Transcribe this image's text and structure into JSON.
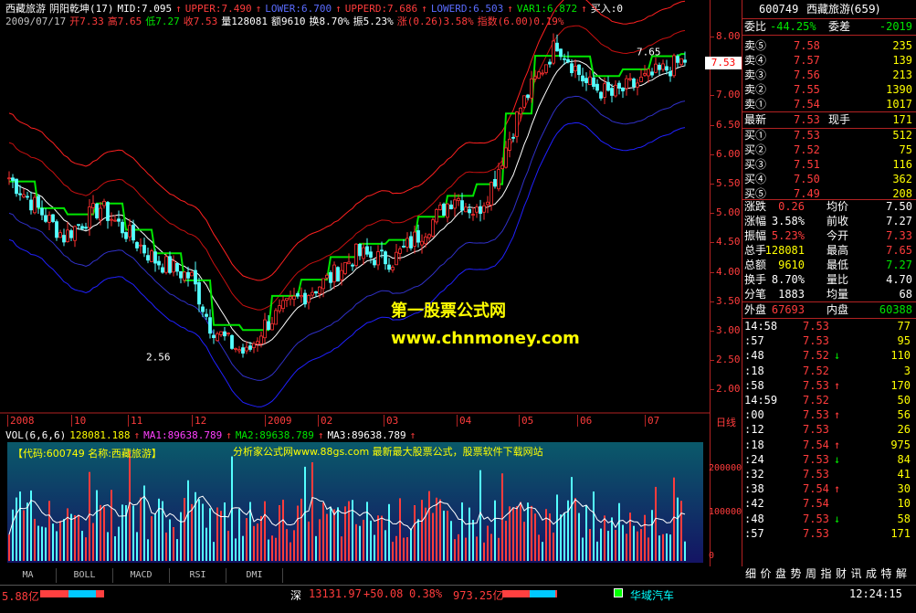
{
  "header": {
    "line1": [
      {
        "t": "西藏旅游",
        "c": "wht"
      },
      {
        "t": "阴阳乾坤(17)",
        "c": "wht"
      },
      {
        "t": "MID:7.095",
        "c": "wht"
      },
      {
        "t": "↑",
        "c": "red"
      },
      {
        "t": "UPPER:7.490",
        "c": "red"
      },
      {
        "t": "↑",
        "c": "red"
      },
      {
        "t": "LOWER:6.700",
        "c": "blu"
      },
      {
        "t": "↑",
        "c": "red"
      },
      {
        "t": "UPPERD:7.686",
        "c": "red"
      },
      {
        "t": "↑",
        "c": "red"
      },
      {
        "t": "LOWERD:6.503",
        "c": "blu"
      },
      {
        "t": "↑",
        "c": "red"
      },
      {
        "t": "VAR1:6.872",
        "c": "grn"
      },
      {
        "t": "↑",
        "c": "red"
      },
      {
        "t": "买入:0",
        "c": "wht"
      }
    ],
    "line2": [
      {
        "t": "2009/07/17",
        "c": "gry"
      },
      {
        "t": "开7.33",
        "c": "red"
      },
      {
        "t": "高7.65",
        "c": "red"
      },
      {
        "t": "低7.27",
        "c": "grn"
      },
      {
        "t": "收7.53",
        "c": "red"
      },
      {
        "t": "量128081",
        "c": "wht"
      },
      {
        "t": "额9610",
        "c": "wht"
      },
      {
        "t": "换8.70%",
        "c": "wht"
      },
      {
        "t": "振5.23%",
        "c": "wht"
      },
      {
        "t": "涨(0.26)3.58%",
        "c": "red"
      },
      {
        "t": "指数(6.00)0.19%",
        "c": "red"
      }
    ]
  },
  "chart": {
    "y_ticks": [
      "8.00",
      "7.50",
      "7.00",
      "6.50",
      "6.00",
      "5.50",
      "5.00",
      "4.50",
      "4.00",
      "3.50",
      "3.00",
      "2.50",
      "2.00"
    ],
    "current_price_label": "7.53",
    "high_label": "7.65",
    "low_label": "2.56",
    "x_labels": [
      "2008",
      "10",
      "11",
      "12",
      "2009",
      "02",
      "03",
      "04",
      "05",
      "06",
      "07"
    ],
    "period": "日线",
    "watermark_title": "第一股票公式网",
    "watermark_url": "www.chnmoney.com"
  },
  "volume": {
    "header": [
      {
        "t": "VOL(6,6,6)",
        "c": "wht"
      },
      {
        "t": "128081.188",
        "c": "yel"
      },
      {
        "t": "↑",
        "c": "red"
      },
      {
        "t": "MA1:89638.789",
        "c": "mag"
      },
      {
        "t": "↑",
        "c": "red"
      },
      {
        "t": "MA2:89638.789",
        "c": "grn"
      },
      {
        "t": "↑",
        "c": "red"
      },
      {
        "t": "MA3:89638.789",
        "c": "wht"
      },
      {
        "t": "↑",
        "c": "red"
      }
    ],
    "stock_info": "【代码:600749 名称:西藏旅游】",
    "banner": "分析家公式网www.88gs.com 最新最大股票公式，股票软件下载网站",
    "y_ticks": [
      "200000",
      "100000",
      "0"
    ]
  },
  "quote": {
    "code": "600749",
    "name": "西藏旅游(659)",
    "weibi_label": "委比",
    "weibi": "-44.25%",
    "weicha_label": "委差",
    "weicha": "-2019",
    "asks": [
      [
        "卖⑤",
        "7.58",
        "235"
      ],
      [
        "卖④",
        "7.57",
        "139"
      ],
      [
        "卖③",
        "7.56",
        "213"
      ],
      [
        "卖②",
        "7.55",
        "1390"
      ],
      [
        "卖①",
        "7.54",
        "1017"
      ]
    ],
    "latest": [
      "最新",
      "7.53",
      "现手",
      "171"
    ],
    "bids": [
      [
        "买①",
        "7.53",
        "512"
      ],
      [
        "买②",
        "7.52",
        "75"
      ],
      [
        "买③",
        "7.51",
        "116"
      ],
      [
        "买④",
        "7.50",
        "362"
      ],
      [
        "买⑤",
        "7.49",
        "208"
      ]
    ],
    "stats": [
      [
        "涨跌",
        "0.26",
        "均价",
        "7.50"
      ],
      [
        "涨幅",
        "3.58%",
        "前收",
        "7.27"
      ],
      [
        "振幅",
        "5.23%",
        "今开",
        "7.33"
      ],
      [
        "总手",
        "128081",
        "最高",
        "7.65"
      ],
      [
        "总额",
        "9610",
        "最低",
        "7.27"
      ],
      [
        "换手",
        "8.70%",
        "量比",
        "4.70"
      ],
      [
        "分笔",
        "1883",
        "均量",
        "68"
      ]
    ],
    "waipan": [
      "外盘",
      "67693",
      "内盘",
      "60388"
    ],
    "ticks": [
      [
        "14:58",
        "7.53",
        "",
        "77"
      ],
      [
        ":57",
        "7.53",
        "",
        "95"
      ],
      [
        ":48",
        "7.52",
        "↓",
        "110"
      ],
      [
        ":18",
        "7.52",
        "",
        "3"
      ],
      [
        ":58",
        "7.53",
        "↑",
        "170"
      ],
      [
        "14:59",
        "7.52",
        "",
        "50"
      ],
      [
        ":00",
        "7.53",
        "↑",
        "56"
      ],
      [
        ":12",
        "7.53",
        "",
        "26"
      ],
      [
        ":18",
        "7.54",
        "↑",
        "975"
      ],
      [
        ":24",
        "7.53",
        "↓",
        "84"
      ],
      [
        ":32",
        "7.53",
        "",
        "41"
      ],
      [
        ":38",
        "7.54",
        "↑",
        "30"
      ],
      [
        ":42",
        "7.54",
        "",
        "10"
      ],
      [
        ":48",
        "7.53",
        "↓",
        "58"
      ],
      [
        ":57",
        "7.53",
        "",
        "171"
      ]
    ],
    "bottom_tabs": [
      "细",
      "价",
      "盘",
      "势",
      "周",
      "指",
      "财",
      "讯",
      "成",
      "特",
      "解"
    ]
  },
  "tabs": [
    "MA",
    "BOLL",
    "MACD",
    "RSI",
    "DMI"
  ],
  "status": {
    "left": "5.88亿",
    "shen_label": "深",
    "shen_index": "13131.97",
    "shen_change": "+50.08",
    "shen_pct": "0.38%",
    "shen_amount": "973.25亿",
    "ticker": "华域汽车",
    "time": "12:24:15"
  }
}
